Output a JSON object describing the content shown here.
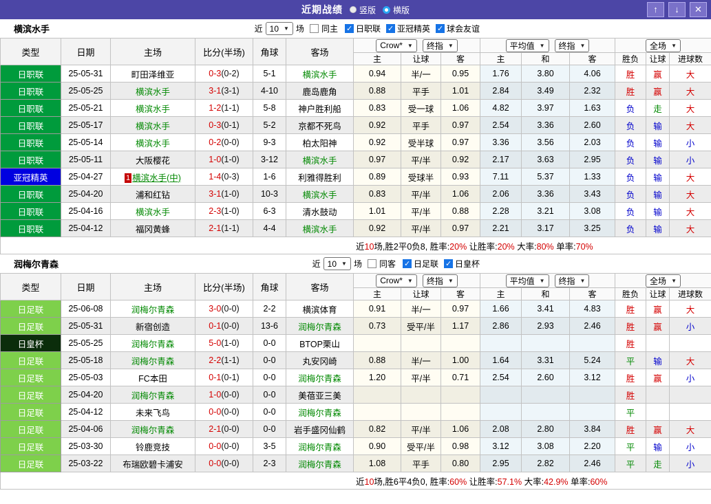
{
  "colors": {
    "title_bar": "#4c46a6",
    "league": {
      "日职联": "#009b3c",
      "亚冠精英": "#0000e0",
      "日足联": "#7ed04b",
      "日皇杯": "#0b2d0b"
    },
    "result": {
      "胜": "#d40000",
      "平": "#008800",
      "负": "#0000cc",
      "赢": "#d40000",
      "走": "#008800",
      "输": "#0000cc",
      "大": "#d40000",
      "小": "#0000cc"
    },
    "focus_team": "#008800",
    "score_red": "#d40000",
    "summary_red": "#d40000"
  },
  "titlebar": {
    "title": "近期战绩",
    "radio_vertical": "竖版",
    "radio_horizontal": "横版",
    "up_icon": "↑",
    "down_icon": "↓",
    "close_icon": "✕"
  },
  "table_header": {
    "columns": [
      "类型",
      "日期",
      "主场",
      "比分(半场)",
      "角球",
      "客场"
    ],
    "subcolumns": [
      "主",
      "让球",
      "客",
      "主",
      "和",
      "客",
      "胜负",
      "让球",
      "进球数"
    ],
    "dropdowns": {
      "g1": [
        "Crow*",
        "终指"
      ],
      "g2": [
        "平均值",
        "终指"
      ],
      "g3": [
        "全场"
      ]
    }
  },
  "sections": [
    {
      "team": "横滨水手",
      "filter": {
        "near": "近",
        "count": "10",
        "games": "场",
        "same": "同主",
        "same_checked": false,
        "leagues": [
          {
            "label": "日职联",
            "checked": true
          },
          {
            "label": "亚冠精英",
            "checked": true
          },
          {
            "label": "球会友谊",
            "checked": true
          }
        ]
      },
      "rows": [
        {
          "league": "日职联",
          "date": "25-05-31",
          "home": {
            "name": "町田泽维亚"
          },
          "score": "0-3",
          "half": "(0-2)",
          "corners": "5-1",
          "away": {
            "name": "横滨水手",
            "focus": true
          },
          "odds1": [
            "0.94",
            "半/一",
            "0.95"
          ],
          "odds2": [
            "1.76",
            "3.80",
            "4.06"
          ],
          "results": [
            "胜",
            "赢",
            "大"
          ]
        },
        {
          "league": "日职联",
          "date": "25-05-25",
          "home": {
            "name": "横滨水手",
            "focus": true
          },
          "score": "3-1",
          "half": "(3-1)",
          "corners": "4-10",
          "away": {
            "name": "鹿岛鹿角"
          },
          "odds1": [
            "0.88",
            "平手",
            "1.01"
          ],
          "odds2": [
            "2.84",
            "3.49",
            "2.32"
          ],
          "results": [
            "胜",
            "赢",
            "大"
          ]
        },
        {
          "league": "日职联",
          "date": "25-05-21",
          "home": {
            "name": "横滨水手",
            "focus": true
          },
          "score": "1-2",
          "half": "(1-1)",
          "corners": "5-8",
          "away": {
            "name": "神户胜利船"
          },
          "odds1": [
            "0.83",
            "受一球",
            "1.06"
          ],
          "odds2": [
            "4.82",
            "3.97",
            "1.63"
          ],
          "results": [
            "负",
            "走",
            "大"
          ]
        },
        {
          "league": "日职联",
          "date": "25-05-17",
          "home": {
            "name": "横滨水手",
            "focus": true
          },
          "score": "0-3",
          "half": "(0-1)",
          "corners": "5-2",
          "away": {
            "name": "京都不死鸟"
          },
          "odds1": [
            "0.92",
            "平手",
            "0.97"
          ],
          "odds2": [
            "2.54",
            "3.36",
            "2.60"
          ],
          "results": [
            "负",
            "输",
            "大"
          ]
        },
        {
          "league": "日职联",
          "date": "25-05-14",
          "home": {
            "name": "横滨水手",
            "focus": true
          },
          "score": "0-2",
          "half": "(0-0)",
          "corners": "9-3",
          "away": {
            "name": "柏太阳神"
          },
          "odds1": [
            "0.92",
            "受半球",
            "0.97"
          ],
          "odds2": [
            "3.36",
            "3.56",
            "2.03"
          ],
          "results": [
            "负",
            "输",
            "小"
          ]
        },
        {
          "league": "日职联",
          "date": "25-05-11",
          "home": {
            "name": "大阪樱花"
          },
          "score": "1-0",
          "half": "(1-0)",
          "corners": "3-12",
          "away": {
            "name": "横滨水手",
            "focus": true
          },
          "odds1": [
            "0.97",
            "平/半",
            "0.92"
          ],
          "odds2": [
            "2.17",
            "3.63",
            "2.95"
          ],
          "results": [
            "负",
            "输",
            "小"
          ]
        },
        {
          "league": "亚冠精英",
          "date": "25-04-27",
          "home": {
            "name": "横滨水手(中)",
            "focus": true,
            "badge": "1",
            "underline": true
          },
          "score": "1-4",
          "half": "(0-3)",
          "corners": "1-6",
          "away": {
            "name": "利雅得胜利"
          },
          "odds1": [
            "0.89",
            "受球半",
            "0.93"
          ],
          "odds2": [
            "7.11",
            "5.37",
            "1.33"
          ],
          "results": [
            "负",
            "输",
            "大"
          ]
        },
        {
          "league": "日职联",
          "date": "25-04-20",
          "home": {
            "name": "浦和红钻"
          },
          "score": "3-1",
          "half": "(1-0)",
          "corners": "10-3",
          "away": {
            "name": "横滨水手",
            "focus": true
          },
          "odds1": [
            "0.83",
            "平/半",
            "1.06"
          ],
          "odds2": [
            "2.06",
            "3.36",
            "3.43"
          ],
          "results": [
            "负",
            "输",
            "大"
          ]
        },
        {
          "league": "日职联",
          "date": "25-04-16",
          "home": {
            "name": "横滨水手",
            "focus": true
          },
          "score": "2-3",
          "half": "(1-0)",
          "corners": "6-3",
          "away": {
            "name": "清水鼓动"
          },
          "odds1": [
            "1.01",
            "平/半",
            "0.88"
          ],
          "odds2": [
            "2.28",
            "3.21",
            "3.08"
          ],
          "results": [
            "负",
            "输",
            "大"
          ]
        },
        {
          "league": "日职联",
          "date": "25-04-12",
          "home": {
            "name": "福冈黄蜂"
          },
          "score": "2-1",
          "half": "(1-1)",
          "corners": "4-4",
          "away": {
            "name": "横滨水手",
            "focus": true
          },
          "odds1": [
            "0.92",
            "平/半",
            "0.97"
          ],
          "odds2": [
            "2.21",
            "3.17",
            "3.25"
          ],
          "results": [
            "负",
            "输",
            "大"
          ]
        }
      ],
      "summary": [
        {
          "t": "近"
        },
        {
          "t": "10",
          "red": true
        },
        {
          "t": "场,胜2平0负8, 胜率:"
        },
        {
          "t": "20%",
          "red": true
        },
        {
          "t": " 让胜率:"
        },
        {
          "t": "20%",
          "red": true
        },
        {
          "t": " 大率:"
        },
        {
          "t": "80%",
          "red": true
        },
        {
          "t": " 单率:"
        },
        {
          "t": "70%",
          "red": true
        }
      ]
    },
    {
      "team": "润梅尔青森",
      "filter": {
        "near": "近",
        "count": "10",
        "games": "场",
        "same": "同客",
        "same_checked": false,
        "leagues": [
          {
            "label": "日足联",
            "checked": true
          },
          {
            "label": "日皇杯",
            "checked": true
          }
        ]
      },
      "rows": [
        {
          "league": "日足联",
          "date": "25-06-08",
          "home": {
            "name": "润梅尔青森",
            "focus": true
          },
          "score": "3-0",
          "half": "(0-0)",
          "corners": "2-2",
          "away": {
            "name": "横滨体育"
          },
          "odds1": [
            "0.91",
            "半/一",
            "0.97"
          ],
          "odds2": [
            "1.66",
            "3.41",
            "4.83"
          ],
          "results": [
            "胜",
            "赢",
            "大"
          ]
        },
        {
          "league": "日足联",
          "date": "25-05-31",
          "home": {
            "name": "新宿创造"
          },
          "score": "0-1",
          "half": "(0-0)",
          "corners": "13-6",
          "away": {
            "name": "润梅尔青森",
            "focus": true
          },
          "odds1": [
            "0.73",
            "受平/半",
            "1.17"
          ],
          "odds2": [
            "2.86",
            "2.93",
            "2.46"
          ],
          "results": [
            "胜",
            "赢",
            "小"
          ]
        },
        {
          "league": "日皇杯",
          "date": "25-05-25",
          "home": {
            "name": "润梅尔青森",
            "focus": true
          },
          "score": "5-0",
          "half": "(1-0)",
          "corners": "0-0",
          "away": {
            "name": "BTOP栗山"
          },
          "odds1": [
            "",
            "",
            ""
          ],
          "odds2": [
            "",
            "",
            ""
          ],
          "results": [
            "胜",
            "",
            ""
          ]
        },
        {
          "league": "日足联",
          "date": "25-05-18",
          "home": {
            "name": "润梅尔青森",
            "focus": true
          },
          "score": "2-2",
          "half": "(1-1)",
          "corners": "0-0",
          "away": {
            "name": "丸安冈崎"
          },
          "odds1": [
            "0.88",
            "半/一",
            "1.00"
          ],
          "odds2": [
            "1.64",
            "3.31",
            "5.24"
          ],
          "results": [
            "平",
            "输",
            "大"
          ]
        },
        {
          "league": "日足联",
          "date": "25-05-03",
          "home": {
            "name": "FC本田"
          },
          "score": "0-1",
          "half": "(0-1)",
          "corners": "0-0",
          "away": {
            "name": "润梅尔青森",
            "focus": true
          },
          "odds1": [
            "1.20",
            "平/半",
            "0.71"
          ],
          "odds2": [
            "2.54",
            "2.60",
            "3.12"
          ],
          "results": [
            "胜",
            "赢",
            "小"
          ]
        },
        {
          "league": "日足联",
          "date": "25-04-20",
          "home": {
            "name": "润梅尔青森",
            "focus": true
          },
          "score": "1-0",
          "half": "(0-0)",
          "corners": "0-0",
          "away": {
            "name": "美蓓亚三美"
          },
          "odds1": [
            "",
            "",
            ""
          ],
          "odds2": [
            "",
            "",
            ""
          ],
          "results": [
            "胜",
            "",
            ""
          ]
        },
        {
          "league": "日足联",
          "date": "25-04-12",
          "home": {
            "name": "未来飞鸟"
          },
          "score": "0-0",
          "half": "(0-0)",
          "corners": "0-0",
          "away": {
            "name": "润梅尔青森",
            "focus": true
          },
          "odds1": [
            "",
            "",
            ""
          ],
          "odds2": [
            "",
            "",
            ""
          ],
          "results": [
            "平",
            "",
            ""
          ]
        },
        {
          "league": "日足联",
          "date": "25-04-06",
          "home": {
            "name": "润梅尔青森",
            "focus": true
          },
          "score": "2-1",
          "half": "(0-0)",
          "corners": "0-0",
          "away": {
            "name": "岩手盛冈仙鹤"
          },
          "odds1": [
            "0.82",
            "平/半",
            "1.06"
          ],
          "odds2": [
            "2.08",
            "2.80",
            "3.84"
          ],
          "results": [
            "胜",
            "赢",
            "大"
          ]
        },
        {
          "league": "日足联",
          "date": "25-03-30",
          "home": {
            "name": "铃鹿竞技"
          },
          "score": "0-0",
          "half": "(0-0)",
          "corners": "3-5",
          "away": {
            "name": "润梅尔青森",
            "focus": true
          },
          "odds1": [
            "0.90",
            "受平/半",
            "0.98"
          ],
          "odds2": [
            "3.12",
            "3.08",
            "2.20"
          ],
          "results": [
            "平",
            "输",
            "小"
          ]
        },
        {
          "league": "日足联",
          "date": "25-03-22",
          "home": {
            "name": "布瑞欧碧卡浦安"
          },
          "score": "0-0",
          "half": "(0-0)",
          "corners": "2-3",
          "away": {
            "name": "润梅尔青森",
            "focus": true
          },
          "odds1": [
            "1.08",
            "平手",
            "0.80"
          ],
          "odds2": [
            "2.95",
            "2.82",
            "2.46"
          ],
          "results": [
            "平",
            "走",
            "小"
          ]
        }
      ],
      "summary": [
        {
          "t": "近"
        },
        {
          "t": "10",
          "red": true
        },
        {
          "t": "场,胜6平4负0, 胜率:"
        },
        {
          "t": "60%",
          "red": true
        },
        {
          "t": " 让胜率:"
        },
        {
          "t": "57.1%",
          "red": true
        },
        {
          "t": " 大率:"
        },
        {
          "t": "42.9%",
          "red": true
        },
        {
          "t": " 单率:"
        },
        {
          "t": "60%",
          "red": true
        }
      ]
    }
  ]
}
